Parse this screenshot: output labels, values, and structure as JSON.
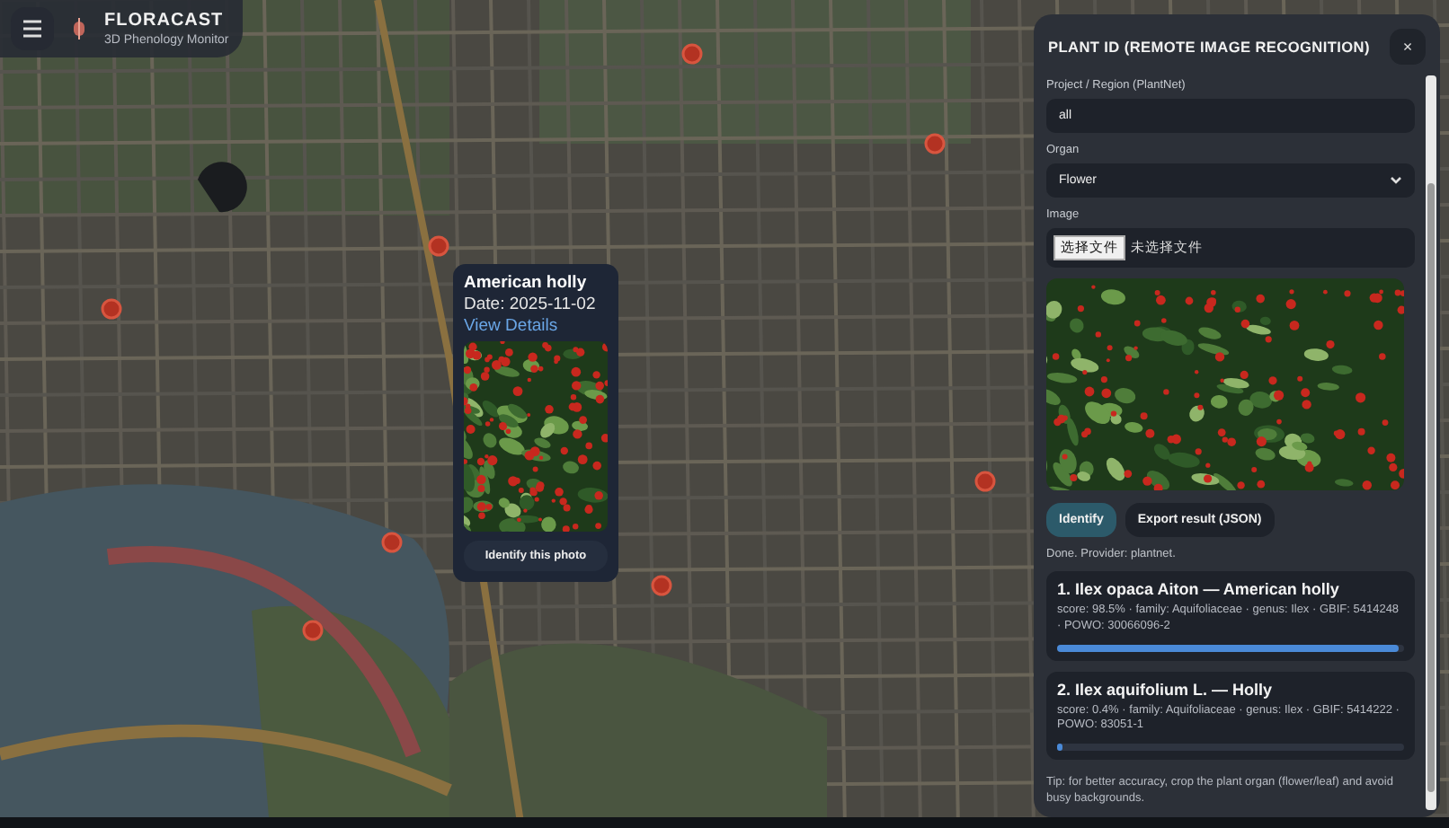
{
  "brand": {
    "title": "FLORACAST",
    "subtitle": "3D Phenology Monitor"
  },
  "popup": {
    "title": "American holly",
    "date": "Date: 2025-11-02",
    "link": "View Details",
    "button": "Identify this photo"
  },
  "panel": {
    "title": "PLANT ID (REMOTE IMAGE RECOGNITION)",
    "close": "×",
    "fields": [
      {
        "kind": "text",
        "label": "Project / Region (PlantNet)",
        "value": "all"
      },
      {
        "kind": "select",
        "label": "Organ",
        "value": "Flower"
      },
      {
        "kind": "file",
        "label": "Image",
        "button": "选择文件",
        "status": "未选择文件"
      }
    ],
    "buttons": [
      {
        "kind": "primary",
        "label": "Identify"
      },
      {
        "kind": "secondary",
        "label": "Export result (JSON)"
      }
    ],
    "status": "Done. Provider: plantnet.",
    "results": [
      {
        "title": "1. Ilex opaca Aiton — American holly",
        "details": "score: 98.5% · family: Aquifoliaceae · genus: Ilex · GBIF: 5414248 · POWO: 30066096-2",
        "level": 0.985
      },
      {
        "title": "2. Ilex aquifolium L. — Holly",
        "details": "score: 0.4% · family: Aquifoliaceae · genus: Ilex · GBIF: 5414222 · POWO: 83051-1",
        "level": 0.004
      }
    ],
    "tip": "Tip: for better accuracy, crop the plant organ (flower/leaf) and avoid busy backgrounds."
  }
}
